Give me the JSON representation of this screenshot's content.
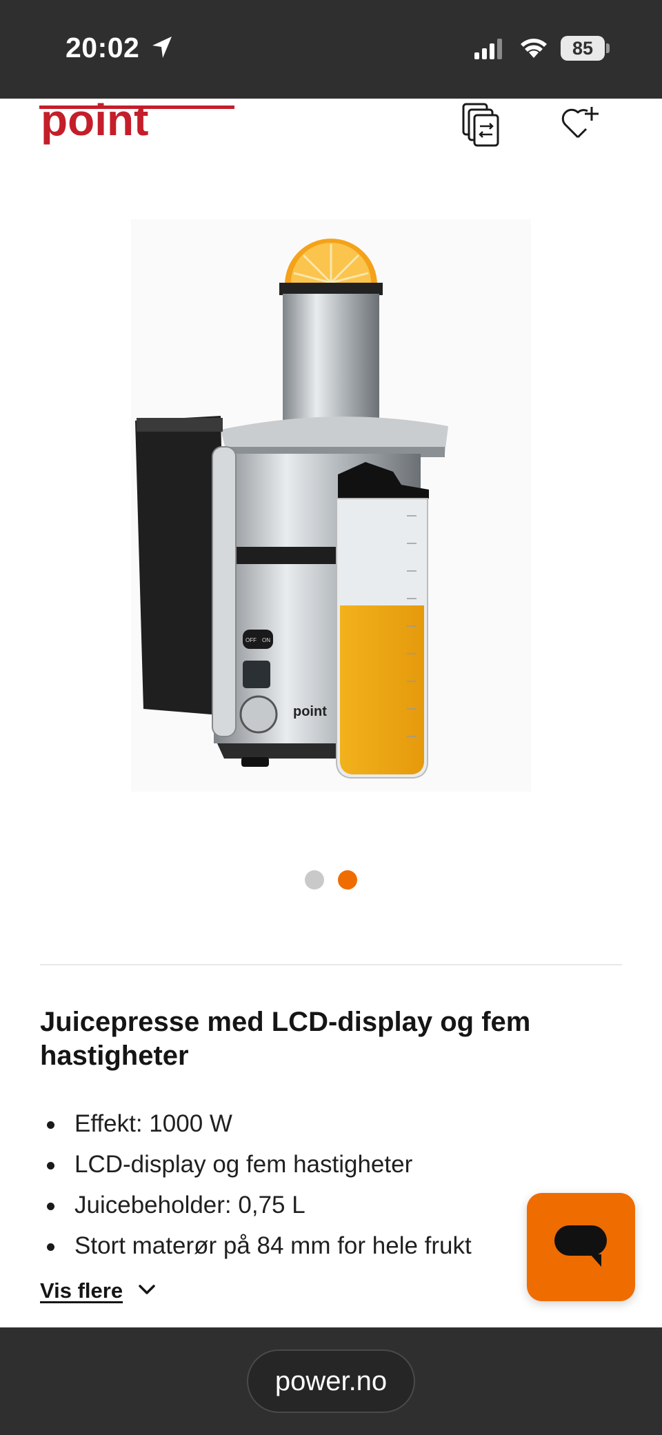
{
  "status_bar": {
    "time": "20:02",
    "battery": "85"
  },
  "header": {
    "brand": "point"
  },
  "product_image": {
    "brand_on_product": "point",
    "controls": [
      "OFF",
      "ON"
    ]
  },
  "carousel": {
    "total": 2,
    "active_index": 2
  },
  "product": {
    "title": "Juicepresse med LCD-display og fem hastigheter",
    "features": [
      "Effekt: 1000 W",
      "LCD-display og fem hastigheter",
      "Juicebeholder: 0,75 L",
      "Stort materør på 84 mm for hele frukt"
    ],
    "show_more_label": "Vis flere"
  },
  "browser": {
    "url": "power.no"
  },
  "colors": {
    "brand_red": "#c41e2a",
    "accent_orange": "#ef6c00",
    "dark_bar": "#2f2f2f"
  }
}
